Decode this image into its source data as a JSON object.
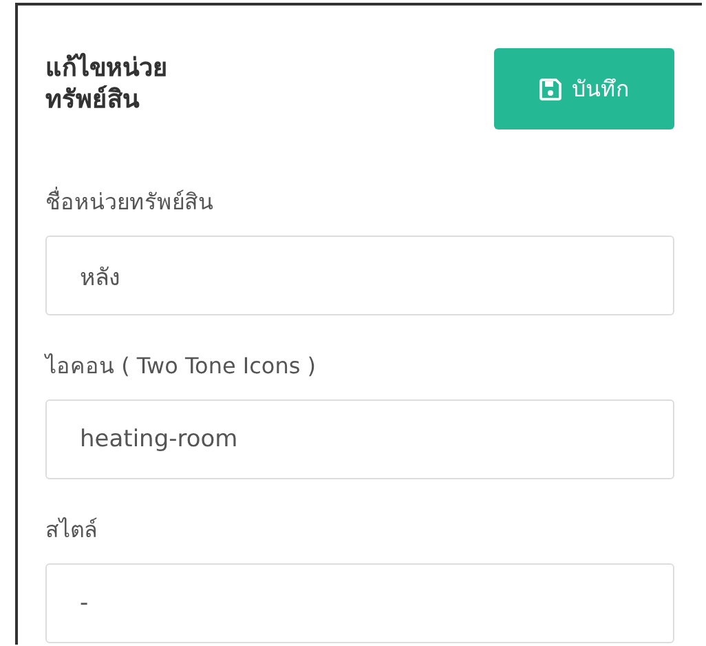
{
  "header": {
    "title": "แก้ไขหน่วย\nทรัพย์สิน",
    "save_button": "บันทึก"
  },
  "fields": [
    {
      "label": "ชื่อหน่วยทรัพย์สิน",
      "value": "หลัง"
    },
    {
      "label": "ไอคอน ( Two Tone Icons )",
      "value": "heating-room"
    },
    {
      "label": "สไตล์",
      "value": "-"
    }
  ]
}
